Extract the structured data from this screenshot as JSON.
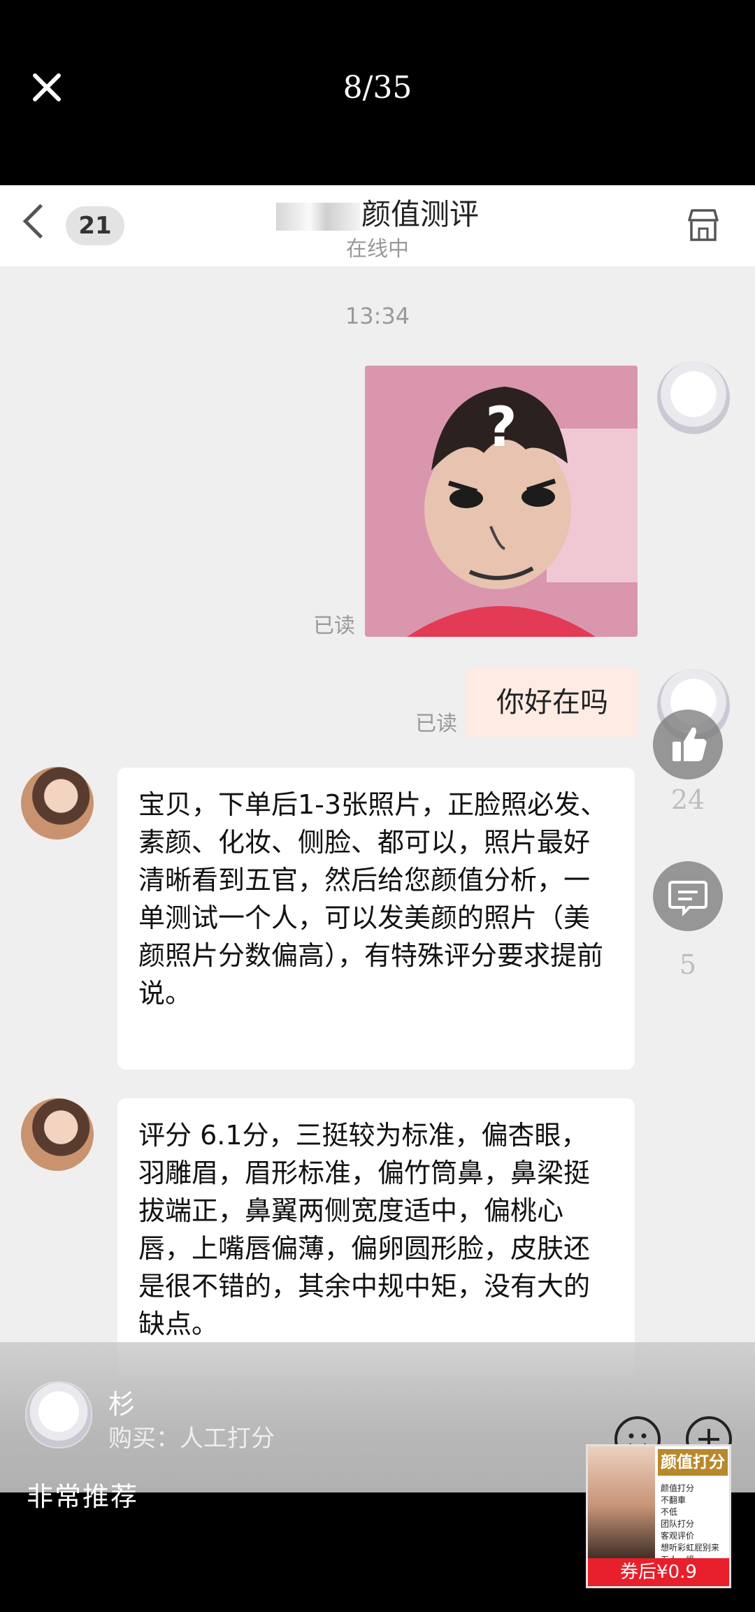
{
  "viewer": {
    "counter": "8/35"
  },
  "chat_header": {
    "unread_count": "21",
    "title": "颜值测评",
    "status": "在线中"
  },
  "messages": {
    "time": "13:34",
    "read_label": "已读",
    "sent_text": "你好在吗",
    "reply1": "宝贝，下单后1-3张照片，正脸照必发、素颜、化妆、侧脸、都可以，照片最好清晰看到五官，然后给您颜值分析，一单测试一个人，可以发美颜的照片（美颜照片分数偏高），有特殊评分要求提前说。",
    "reply2": "评分 6.1分，三挺较为标准，偏杏眼，羽雕眉，眉形标准，偏竹筒鼻，鼻梁挺拔端正，鼻翼两侧宽度适中，偏桃心唇，上嘴唇偏薄，偏卵圆形脸，皮肤还是很不错的，其余中规中矩，没有大的缺点。"
  },
  "side_actions": {
    "likes": "24",
    "comments": "5"
  },
  "review": {
    "username": "杉",
    "purchase": "购买：人工打分",
    "text": "非常推荐"
  },
  "ad": {
    "title": "颜值打分",
    "features": "颜值打分\n不翻車\n不低\n团队打分\n客观评价\n想听彩虹屁别来\n五人一组",
    "price": "券后¥0.9",
    "price_color": "#e8202b"
  }
}
